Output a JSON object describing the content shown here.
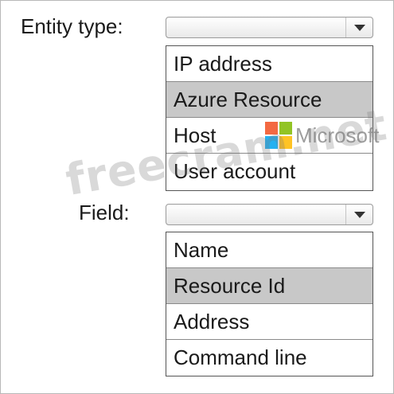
{
  "entity_type": {
    "label": "Entity type:",
    "selected_value": "",
    "options": [
      "IP address",
      "Azure Resource",
      "Host",
      "User account"
    ],
    "highlighted_option": "Azure Resource"
  },
  "field": {
    "label": "Field:",
    "selected_value": "",
    "options": [
      "Name",
      "Resource Id",
      "Address",
      "Command line"
    ],
    "highlighted_option": "Resource Id"
  },
  "logo": {
    "text": "Microsoft",
    "colors": [
      "#f25022",
      "#7fba00",
      "#00a4ef",
      "#ffb900"
    ]
  },
  "watermark": {
    "text": "freecram.net"
  },
  "colors": {
    "highlight": "#c8c8c8",
    "border": "#555555"
  }
}
